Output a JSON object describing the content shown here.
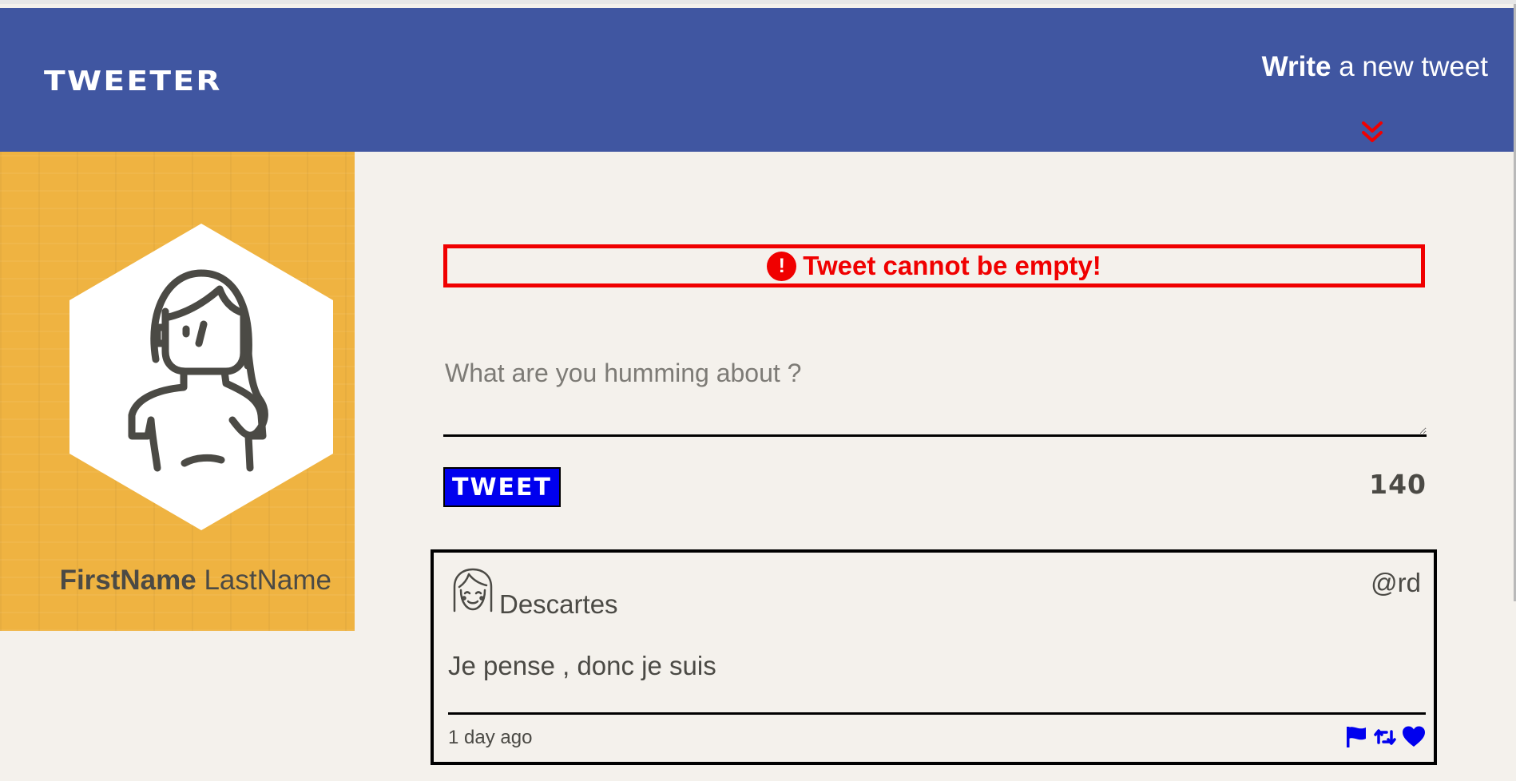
{
  "nav": {
    "brand": "TWEETER",
    "compose_bold": "Write",
    "compose_rest": " a new tweet",
    "compose_icon": "double-chevron-down-icon",
    "accent_color": "#4056a1",
    "arrow_color": "#f00000"
  },
  "profile": {
    "first_name": "FirstName",
    "last_name": "LastName",
    "avatar_icon": "user-avatar-icon",
    "panel_color": "#efb341"
  },
  "composer": {
    "error_text": "Tweet cannot be empty!",
    "error_icon": "alert-icon",
    "placeholder": "What are you humming about ?",
    "value": "",
    "tweet_button_label": "TWEET",
    "counter": "140"
  },
  "tweets": [
    {
      "name": "Descartes",
      "handle": "@rd",
      "body": "Je pense , donc je suis",
      "time": "1 day ago",
      "avatar_icon": "user-avatar-icon",
      "actions": [
        "flag-icon",
        "retweet-icon",
        "heart-icon"
      ]
    }
  ]
}
